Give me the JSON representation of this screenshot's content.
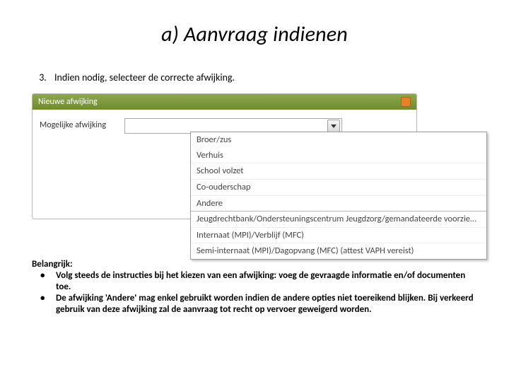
{
  "title": "a) Aanvraag indienen",
  "step_number_display": "3.",
  "step_text": "Indien nodig, selecteer de correcte afwijking.",
  "panel": {
    "header_title": "Nieuwe afwijking",
    "field_label": "Mogelijke afwijking"
  },
  "dropdown_options": [
    {
      "label": "Broer/zus"
    },
    {
      "label": "Verhuis"
    },
    {
      "label": "School volzet"
    },
    {
      "label": "Co-ouderschap"
    },
    {
      "label": "Andere"
    },
    {
      "label": "Jeugdrechtbank/Ondersteuningscentrum Jeugdzorg/gemandateerde voorziening",
      "sep": true
    },
    {
      "label": "Internaat (MPI)/Verblijf (MFC)"
    },
    {
      "label": "Semi-internaat (MPI)/Dagopvang (MFC) (attest VAPH vereist)"
    }
  ],
  "notes": {
    "heading": "Belangrijk:",
    "items": [
      "Volg steeds de instructies bij het kiezen van een afwijking: voeg de gevraagde informatie en/of documenten toe.",
      "De afwijking 'Andere' mag enkel gebruikt worden indien de andere opties niet toereikend blijken. Bij verkeerd gebruik van deze afwijking zal de aanvraag tot recht op vervoer geweigerd worden."
    ]
  }
}
